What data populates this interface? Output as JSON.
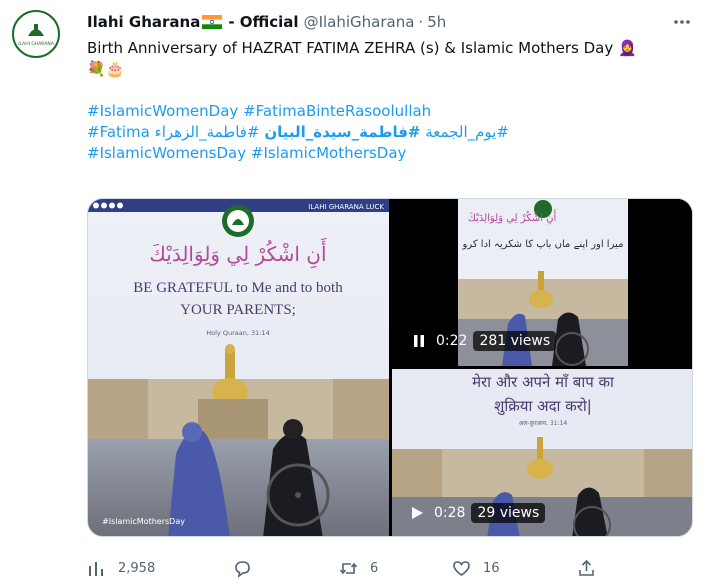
{
  "tweet": {
    "display_name": "Ilahi Gharana",
    "display_name_suffix": " - Official",
    "handle": "@IlahiGharana",
    "separator": "·",
    "time": "5h",
    "avatar_text": "ILAHI GHARANA",
    "text_line1": "Birth Anniversary of HAZRAT FATIMA ZEHRA (s) & Islamic Mothers Day 🧕",
    "text_line2": "💐🎂",
    "hashtags_line1": [
      "#IslamicWomenDay",
      "#FatimaBinteRasoolullah"
    ],
    "hashtags_line2_a": "#Fatima",
    "hashtags_line2_b": "#فاطمة_الزهراء",
    "hashtags_line2_c": "#فاطمة_سيدة_البيان",
    "hashtags_line2_d": "#يوم_الجمعة",
    "hashtags_line3": [
      "#IslamicWomensDay",
      "#IslamicMothersDay"
    ]
  },
  "media": {
    "left": {
      "header_text": "ILAHI GHARANA LUCK",
      "arabic_verse": "أَنِ اشْكُرْ لِي وَلِوَالِدَيْكَ",
      "english_line1": "BE GRATEFUL to Me and to both",
      "english_line2": "YOUR PARENTS;",
      "citation": "Holy Quraan, 31:14",
      "hashtag": "#IslamicMothersDay"
    },
    "top_right": {
      "arabic_verse": "أَنِ اشْكُرْ لِي وَلِوَالِدَيْكَ",
      "urdu_line": "میرا اور اپنے ماں باپ کا شکریہ ادا کرو",
      "time": "0:22",
      "views": "281 views",
      "state": "playing"
    },
    "bottom_right": {
      "hindi_line1": "मेरा और अपने माँ बाप का",
      "hindi_line2": "शुक्रिया अदा करो|",
      "citation": "अल-क़ुरआन, 31:14",
      "time": "0:28",
      "views": "29 views",
      "state": "paused"
    }
  },
  "actions": {
    "views": "2,958",
    "replies": "",
    "retweets": "6",
    "likes": "16"
  },
  "colors": {
    "link": "#1d9bf0",
    "muted": "#536471",
    "text": "#0f1419",
    "border": "#cfd9de",
    "brand_green": "#1f6b2a"
  }
}
